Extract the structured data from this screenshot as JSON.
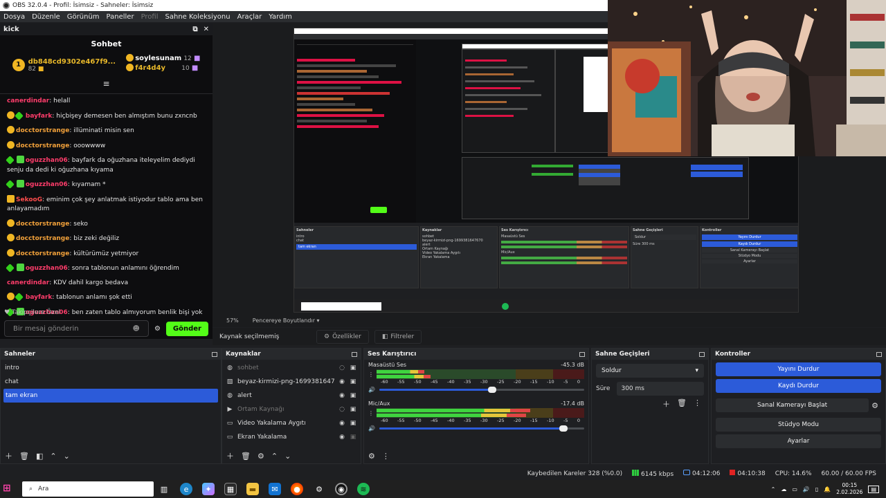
{
  "window": {
    "title": "OBS 32.0.4 - Profil: İsimsiz - Sahneler: İsimsiz"
  },
  "menu": [
    "Dosya",
    "Düzenle",
    "Görünüm",
    "Paneller",
    "Profil",
    "Sahne Koleksiyonu",
    "Araçlar",
    "Yardım"
  ],
  "chat": {
    "dock_title": "kick",
    "title": "Sohbet",
    "top_users": [
      {
        "name": "db848cd9302e467f9...",
        "count": "82"
      },
      {
        "name": "soylesunam",
        "count": "12"
      },
      {
        "name": "f4r4d4y",
        "count": "10"
      }
    ],
    "messages": [
      {
        "user": "canerdindar",
        "text": ": helall"
      },
      {
        "user": "bayfark",
        "text": ": hiçbişey demesen ben almıştım bunu zxncnb"
      },
      {
        "user": "docctorstrange",
        "text": ": illüminati misin sen"
      },
      {
        "user": "docctorstrange",
        "text": ": ooowwww"
      },
      {
        "user": "oguzzhan06",
        "text": ": bayfark da oğuzhana iteleyelim dediydi senju da dedi ki oğuzhana kıyama"
      },
      {
        "user": "oguzzhan06",
        "text": ": kıyamam *"
      },
      {
        "user": "SekooG",
        "text": ": eminim çok şey anlatmak istiyodur tablo ama ben anlayamadım"
      },
      {
        "user": "docctorstrange",
        "text": ": seko"
      },
      {
        "user": "docctorstrange",
        "text": ": biz zeki değiliz"
      },
      {
        "user": "docctorstrange",
        "text": ": kültürümüz yetmiyor"
      },
      {
        "user": "oguzzhan06",
        "text": ": sonra tablonun anlamını öğrendim"
      },
      {
        "user": "canerdindar",
        "text": ": KDV dahil kargo bedava"
      },
      {
        "user": "bayfark",
        "text": ": tablonun anlamı şok etti"
      },
      {
        "user": "oguzzhan06",
        "text": ": ben zaten tablo almıyorum benlik bişi yok"
      }
    ],
    "followers_only": "Takipçilere Özel",
    "input_placeholder": "Bir mesaj gönderin",
    "send_label": "Gönder"
  },
  "preview": {
    "zoom": "57%",
    "fit_mode": "Pencereye Boyutlandır",
    "no_source": "Kaynak seçilmemiş",
    "properties_label": "Özellikler",
    "filters_label": "Filtreler"
  },
  "scenes": {
    "title": "Sahneler",
    "items": [
      {
        "label": "intro"
      },
      {
        "label": "chat"
      },
      {
        "label": "tam ekran"
      }
    ]
  },
  "sources": {
    "title": "Kaynaklar",
    "items": [
      {
        "label": "sohbet",
        "icon": "browser-icon"
      },
      {
        "label": "beyaz-kirmizi-png-1699381647670",
        "icon": "image-icon"
      },
      {
        "label": "alert",
        "icon": "browser-icon"
      },
      {
        "label": "Ortam Kaynağı",
        "icon": "play-icon"
      },
      {
        "label": "Video Yakalama Aygıtı",
        "icon": "camera-icon"
      },
      {
        "label": "Ekran Yakalama",
        "icon": "monitor-icon"
      }
    ]
  },
  "mixer": {
    "title": "Ses Karıştırıcı",
    "tracks": [
      {
        "name": "Masaüstü Ses",
        "db": "-45.3 dB",
        "volume_fraction": 0.55,
        "level1": 0.23,
        "level2": 0.26
      },
      {
        "name": "Mic/Aux",
        "db": "-17.4 dB",
        "volume_fraction": 0.9,
        "level1": 0.74,
        "level2": 0.72
      }
    ],
    "ticks": [
      "-60",
      "-55",
      "-50",
      "-45",
      "-40",
      "-35",
      "-30",
      "-25",
      "-20",
      "-15",
      "-10",
      "-5",
      "0"
    ]
  },
  "transitions": {
    "title": "Sahne Geçişleri",
    "selected": "Soldur",
    "duration_label": "Süre",
    "duration_value": "300 ms"
  },
  "controls": {
    "title": "Kontroller",
    "stop_stream": "Yayını Durdur",
    "stop_record": "Kaydı Durdur",
    "virtual_cam": "Sanal Kamerayı Başlat",
    "studio_mode": "Stüdyo Modu",
    "settings": "Ayarlar"
  },
  "status": {
    "dropped": "Kaybedilen Kareler 328 (%0.0)",
    "bitrate": "6145 kbps",
    "stream_time": "04:12:06",
    "rec_time": "04:10:38",
    "cpu": "CPU: 14.6%",
    "fps": "60.00 / 60.00 FPS"
  },
  "taskbar": {
    "search_placeholder": "Ara",
    "time": "00:15",
    "date": "2.02.2026"
  },
  "colors": {
    "accent": "#2c5bd9",
    "kick_green": "#53fc18"
  }
}
